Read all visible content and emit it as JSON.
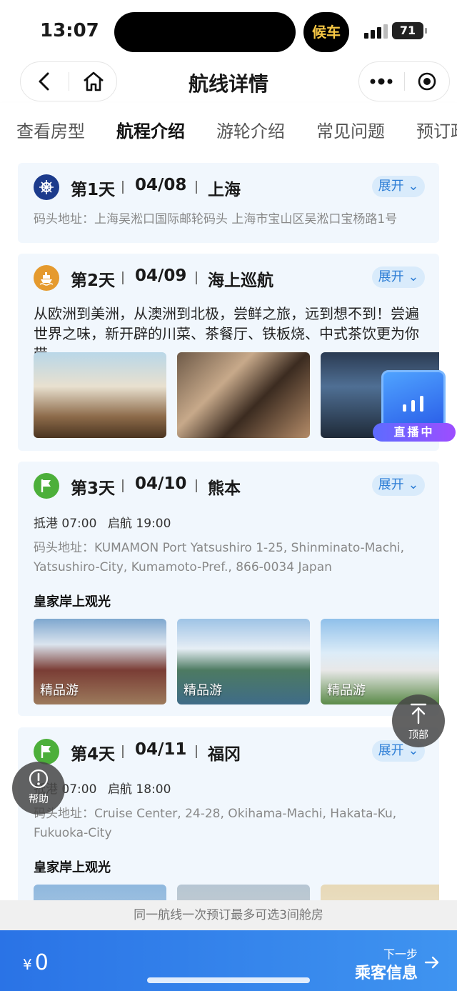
{
  "status": {
    "time": "13:07",
    "wait_pill": "候车",
    "battery": "71"
  },
  "nav": {
    "title": "航线详情"
  },
  "tabs": [
    "查看房型",
    "航程介绍",
    "游轮介绍",
    "常见问题",
    "预订政"
  ],
  "expand_label": "展开",
  "days": [
    {
      "label": "第1天",
      "date": "04/08",
      "port": "上海",
      "address": "码头地址：上海吴淞口国际邮轮码头 上海市宝山区吴淞口宝杨路1号"
    },
    {
      "label": "第2天",
      "date": "04/09",
      "port": "海上巡航",
      "description": "从欧洲到美洲，从澳洲到北极，尝鲜之旅，远到想不到！尝遍世界之味，新开辟的川菜、茶餐厅、铁板烧、中式茶饮更为你带…"
    },
    {
      "label": "第3天",
      "date": "04/10",
      "port": "熊本",
      "arrive": "抵港 07:00",
      "depart": "启航 19:00",
      "address": "码头地址：KUMAMON Port Yatsushiro  1-25, Shinminato-Machi, Yatsushiro-City, Kumamoto-Pref., 866-0034 Japan",
      "section_title": "皇家岸上观光",
      "photo_caption": "精品游"
    },
    {
      "label": "第4天",
      "date": "04/11",
      "port": "福冈",
      "arrive": "抵港 07:00",
      "depart": "启航 18:00",
      "address": "码头地址：Cruise Center, 24-28, Okihama-Machi, Hakata-Ku, Fukuoka-City",
      "section_title": "皇家岸上观光"
    }
  ],
  "floating": {
    "live": "直播中",
    "top": "顶部",
    "help": "帮助"
  },
  "notice": "同一航线一次预订最多可选3间舱房",
  "footer": {
    "currency": "¥",
    "price": "0",
    "next_small": "下一步",
    "next_big": "乘客信息"
  },
  "colors": {
    "accent": "#f2b53a",
    "primary": "#2a73e6",
    "day_icon_1": "#1c3b8c",
    "day_icon_2": "#e59a2e",
    "day_icon_port": "#4caf3a"
  }
}
